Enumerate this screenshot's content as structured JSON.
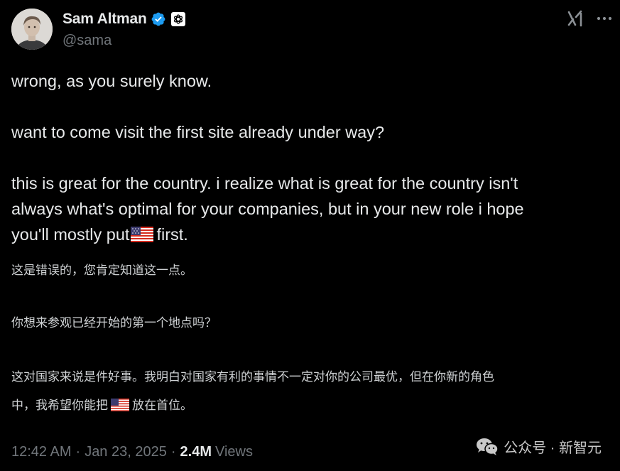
{
  "author": {
    "display_name": "Sam Altman",
    "handle": "@sama",
    "verified_color": "#1d9bf0"
  },
  "icons": {
    "verified": "verified-badge-icon",
    "affiliation": "openai-logo-icon",
    "grok": "grok-icon",
    "more": "more-icon",
    "flag": "us-flag-icon",
    "wechat": "wechat-icon"
  },
  "tweet": {
    "line1": "wrong, as you surely know.",
    "line2": "want to come visit the first site already under way?",
    "line3a": "this is great for the country. i realize what is great for the country isn't",
    "line3b": "always what's optimal for your companies, but in your new role i hope",
    "line3c_before": "you'll mostly put",
    "line3c_after": "first."
  },
  "translation": {
    "line1": "这是错误的，您肯定知道这一点。",
    "line2": "你想来参观已经开始的第一个地点吗？",
    "line3a": "这对国家来说是件好事。我明白对国家有利的事情不一定对你的公司最优，但在你新的角色",
    "line3b_before": "中，我希望你能把",
    "line3b_after": "放在首位。"
  },
  "meta": {
    "time": "12:42 AM",
    "separator": "·",
    "date": "Jan 23, 2025",
    "views_count": "2.4M",
    "views_label": "Views"
  },
  "watermark": {
    "text": "公众号 · 新智元"
  },
  "colors": {
    "background": "#000000",
    "text": "#e7e9ea",
    "secondary": "#71767b",
    "accent": "#1d9bf0"
  }
}
